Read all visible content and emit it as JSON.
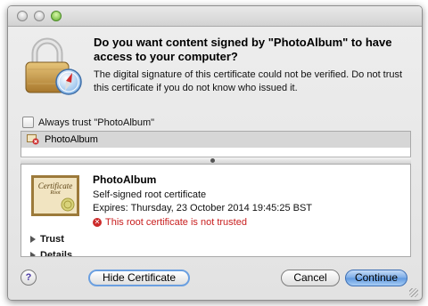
{
  "dialog": {
    "question": "Do you want content signed by \"PhotoAlbum\" to have access to your computer?",
    "info": "The digital signature of this certificate could not be verified. Do not trust this certificate if you do not know who issued it.",
    "always_trust_label": "Always trust \"PhotoAlbum\"",
    "always_trust_checked": false
  },
  "cert_list": {
    "items": [
      {
        "label": "PhotoAlbum",
        "selected": true
      }
    ]
  },
  "cert_detail": {
    "name": "PhotoAlbum",
    "kind": "Self-signed root certificate",
    "expires": "Expires: Thursday, 23 October 2014 19:45:25 BST",
    "warning": "This root certificate is not trusted",
    "trust_label": "Trust",
    "details_label": "Details",
    "thumbnail_text": [
      "Certificate",
      "Root"
    ]
  },
  "buttons": {
    "help": "?",
    "hide_certificate": "Hide Certificate",
    "cancel": "Cancel",
    "continue": "Continue"
  },
  "colors": {
    "warning": "#c81e1e",
    "primary_button": "#5e98df",
    "focus_ring": "#6a9fe0"
  }
}
